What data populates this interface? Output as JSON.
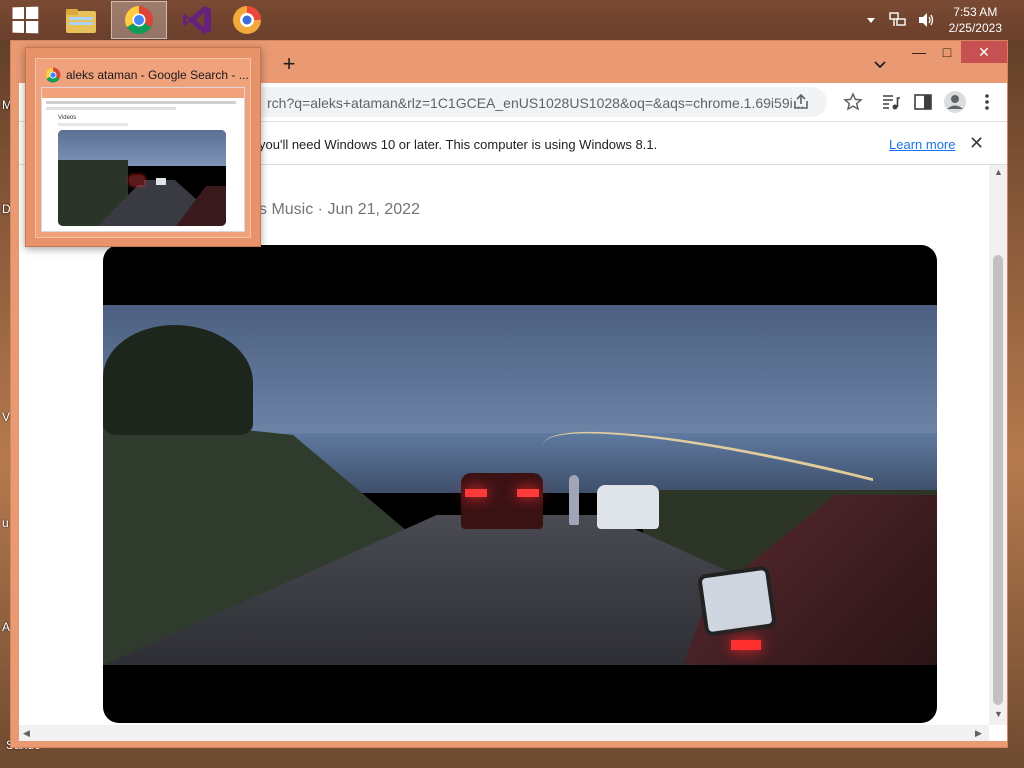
{
  "taskbar": {
    "apps": [
      {
        "name": "start",
        "icon": "windows-logo-icon"
      },
      {
        "name": "file-explorer",
        "icon": "folder-icon"
      },
      {
        "name": "google-chrome",
        "icon": "chrome-icon",
        "active": true
      },
      {
        "name": "visual-studio",
        "icon": "visual-studio-icon"
      },
      {
        "name": "browser-app",
        "icon": "browser-orb-icon"
      }
    ],
    "clock": {
      "time": "7:53 AM",
      "date": "2/25/2023"
    }
  },
  "desktop": {
    "stray_labels": [
      "M",
      "D",
      "V",
      "u",
      "A",
      "Sande"
    ]
  },
  "chrome": {
    "new_tab_label": "+",
    "window_controls": {
      "minimize": "—",
      "maximize": "□",
      "close": "✕"
    },
    "omnibox_url": "rch?q=aleks+ataman&rlz=1C1GCEA_enUS1028US1028&oq=&aqs=chrome.1.69i59i...",
    "infobar": {
      "message": "you'll need Windows 10 or later. This computer is using Windows 8.1.",
      "learn_more": "Learn more",
      "close": "✕"
    },
    "content": {
      "meta_line": "s Music · Jun 21, 2022"
    }
  },
  "preview": {
    "title": "aleks ataman - Google Search - ...",
    "inner_label": "Videos"
  },
  "colors": {
    "window_accent": "#e99a72",
    "link": "#1a73e8",
    "close_button": "#c75050"
  }
}
